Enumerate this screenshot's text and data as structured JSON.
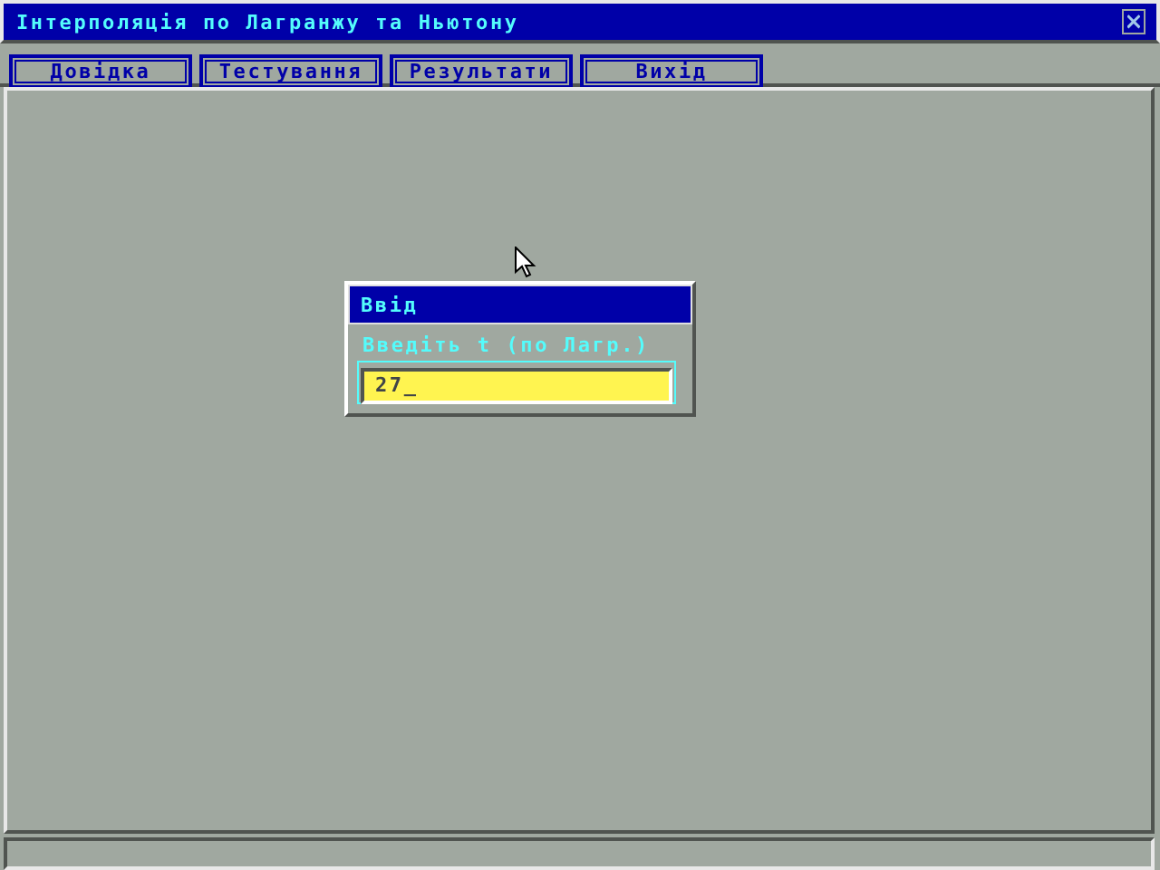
{
  "window": {
    "title": "Інтерполяція по Лагранжу та Ньютону",
    "close_icon": "×"
  },
  "menu": [
    {
      "label": "Довідка"
    },
    {
      "label": "Тестування"
    },
    {
      "label": "Результати"
    },
    {
      "label": "Вихід"
    }
  ],
  "dialog": {
    "title": "Ввід",
    "prompt": "Введіть t (по Лагр.)",
    "value": "27_"
  }
}
